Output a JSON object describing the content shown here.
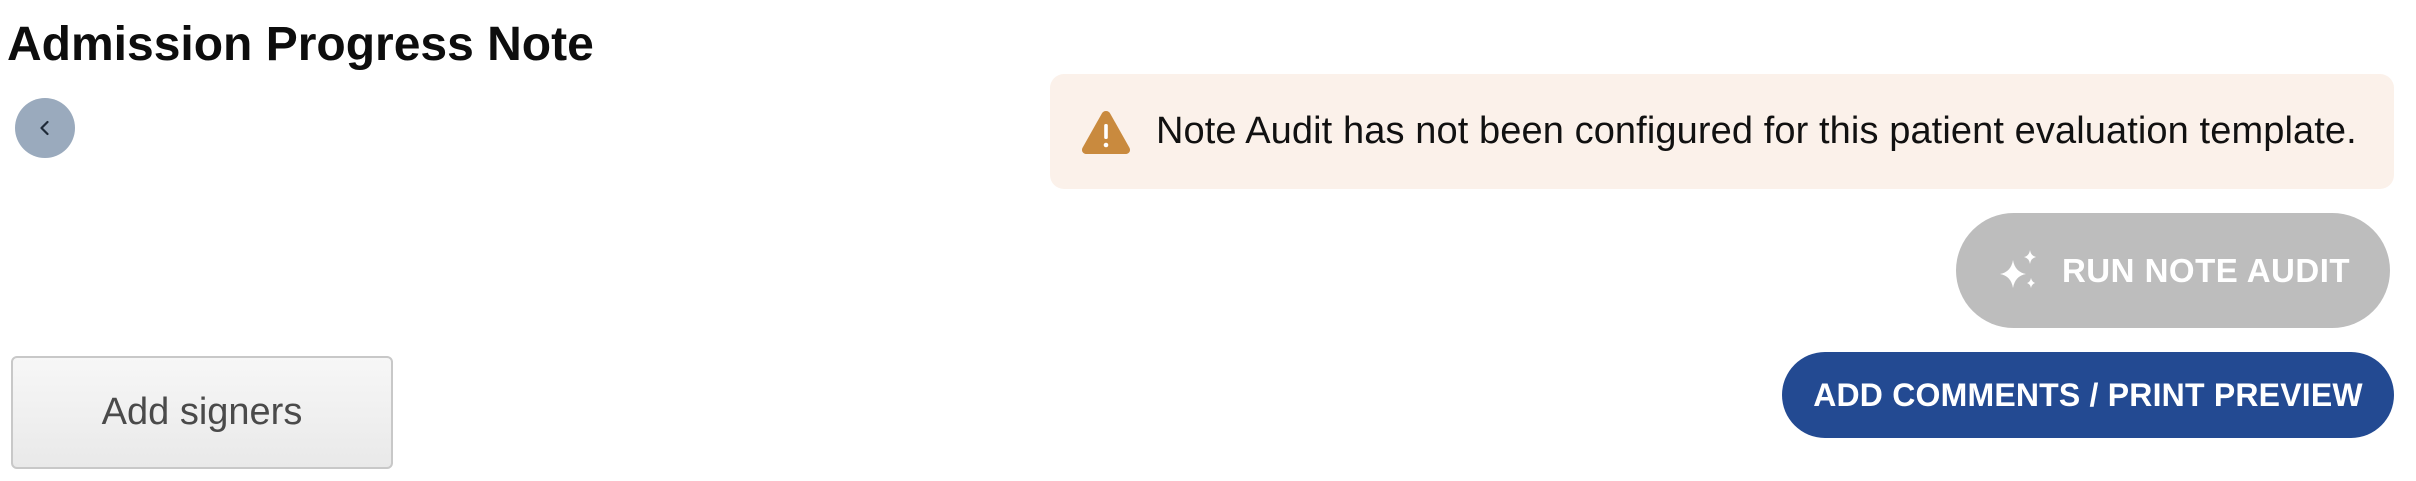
{
  "header": {
    "title": "Admission Progress Note"
  },
  "navigation": {
    "back_icon": "chevron-left-icon"
  },
  "alert": {
    "icon": "warning-triangle-icon",
    "message": "Note Audit has not been configured for this patient evaluation template.",
    "background_color": "#fbf1ea",
    "icon_color": "#c98a3e"
  },
  "actions": {
    "run_note_audit": {
      "label": "RUN NOTE AUDIT",
      "icon": "sparkle-icon",
      "state": "disabled",
      "color": "#bdbdbd"
    },
    "add_signers": {
      "label": "Add signers"
    },
    "add_comments_print_preview": {
      "label": "ADD COMMENTS / PRINT PREVIEW",
      "color": "#234a92"
    }
  }
}
